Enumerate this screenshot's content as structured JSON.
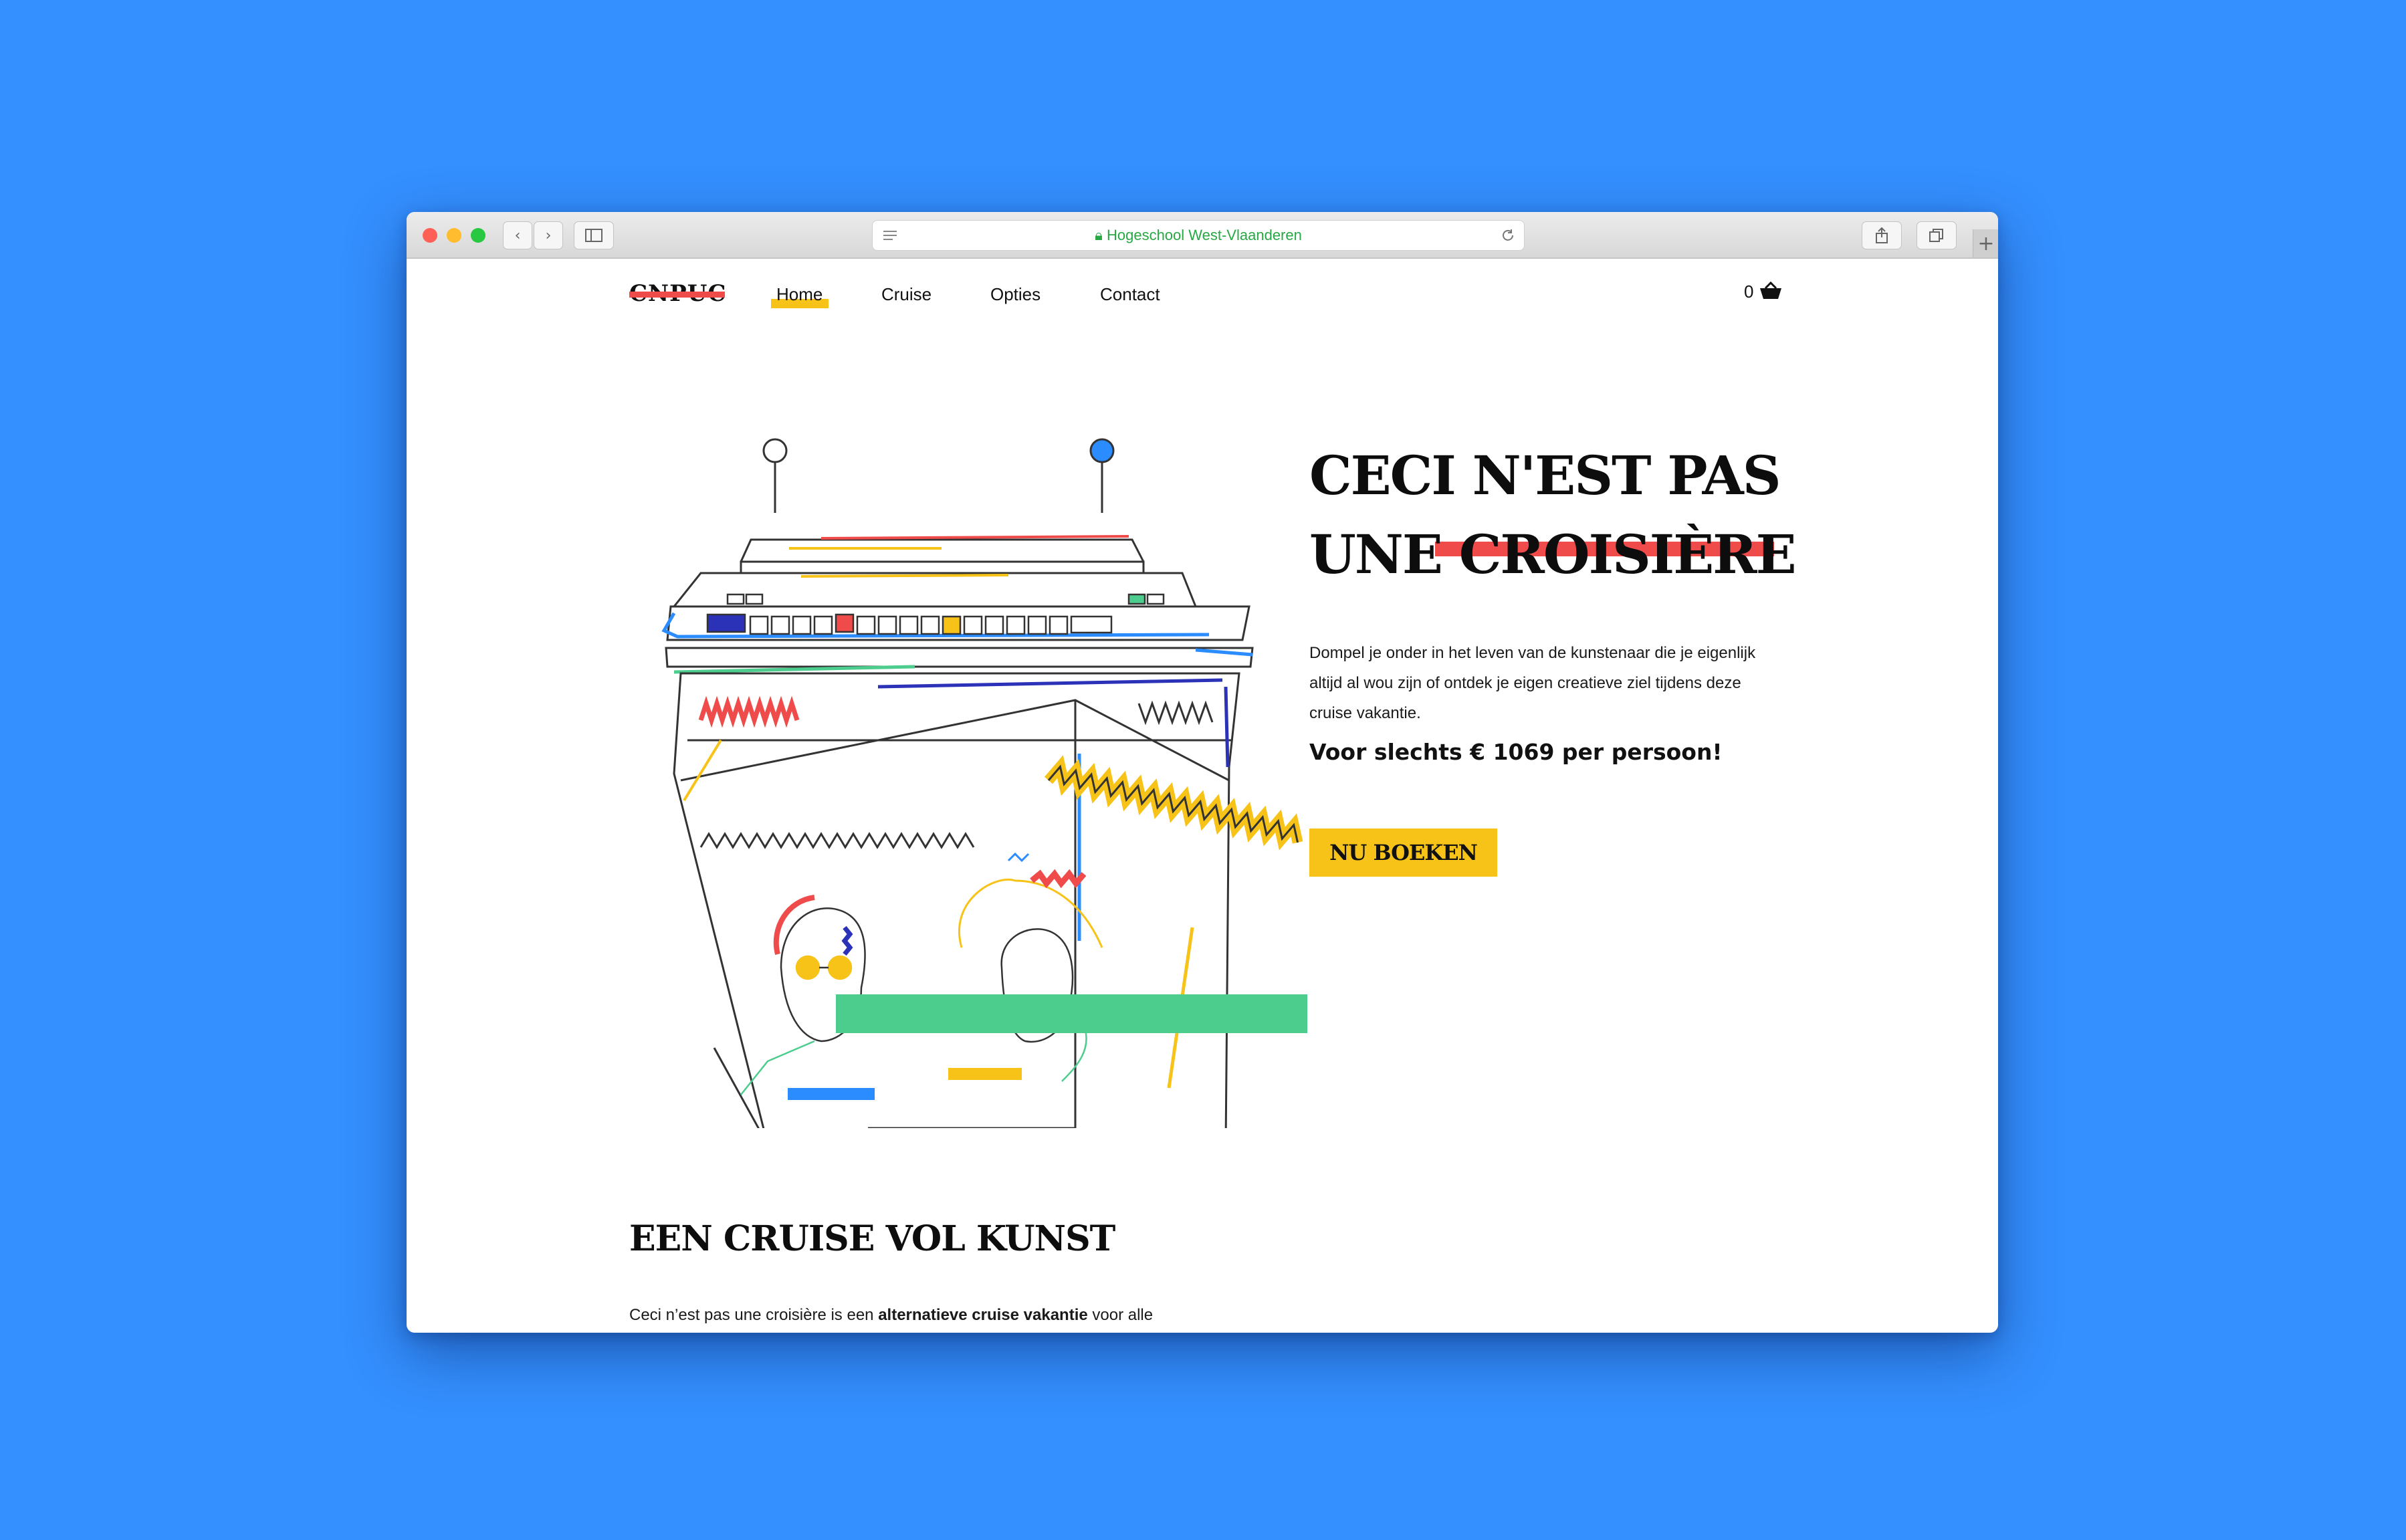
{
  "browser": {
    "url_label": "Hogeschool West-Vlaanderen",
    "colors": {
      "close": "#fe5f57",
      "minimize": "#febc2e",
      "maximize": "#28c840"
    }
  },
  "site": {
    "logo": "CNPUC",
    "nav": [
      {
        "label": "Home",
        "active": true
      },
      {
        "label": "Cruise",
        "active": false
      },
      {
        "label": "Opties",
        "active": false
      },
      {
        "label": "Contact",
        "active": false
      }
    ],
    "cart_count": "0"
  },
  "hero": {
    "title_line1": "CECI N'EST PAS",
    "title_line2_prefix": "UNE",
    "title_line2_struck": "CROISIÈRE",
    "description": "Dompel je onder in het leven van de kunstenaar die je eigenlijk altijd al wou zijn of ontdek je eigen creatieve ziel tijdens deze cruise vakantie.",
    "price": "Voor slechts € 1069 per persoon!",
    "cta_label": "NU BOEKEN"
  },
  "section": {
    "title": "EEN CRUISE VOL KUNST",
    "intro_prefix": "Ceci n’est pas une croisière is een",
    "intro_bold": "alternatieve cruise vakantie",
    "intro_suffix": "voor alle artistieke zielen die meer over kunst willen leren kennen, zich willen"
  },
  "palette": {
    "background": "#3490ff",
    "red": "#ef4b4b",
    "yellow": "#f7c318",
    "green": "#4ccd8e",
    "blue": "#2a8cff",
    "navy": "#2b32b8"
  }
}
